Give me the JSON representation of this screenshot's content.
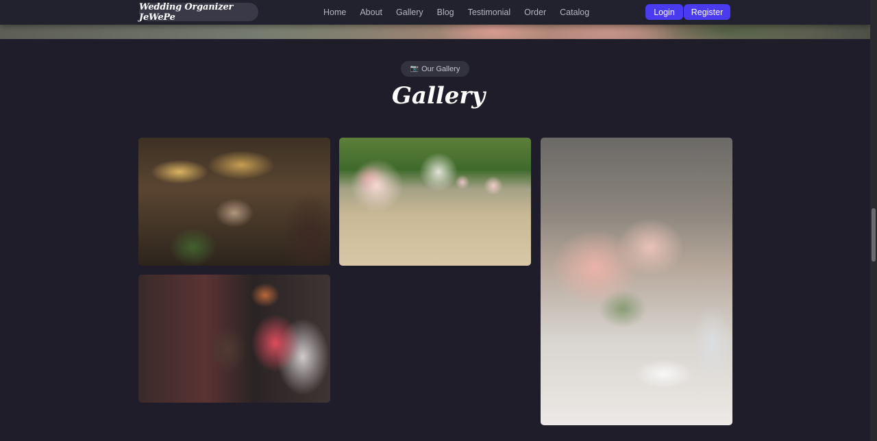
{
  "navbar": {
    "brand": "Wedding Organizer JeWePe",
    "links": [
      "Home",
      "About",
      "Gallery",
      "Blog",
      "Testimonial",
      "Order",
      "Catalog"
    ],
    "login_label": "Login",
    "register_label": "Register"
  },
  "gallery": {
    "badge_icon": "📷",
    "badge_label": "Our Gallery",
    "title": "Gallery",
    "photos": [
      {
        "name": "toast-photo"
      },
      {
        "name": "aisle-photo"
      },
      {
        "name": "couple-photo"
      },
      {
        "name": "table-photo"
      }
    ]
  },
  "colors": {
    "background": "#1e1d29",
    "accent": "#4a3bf0",
    "navbar": "#22212e"
  }
}
